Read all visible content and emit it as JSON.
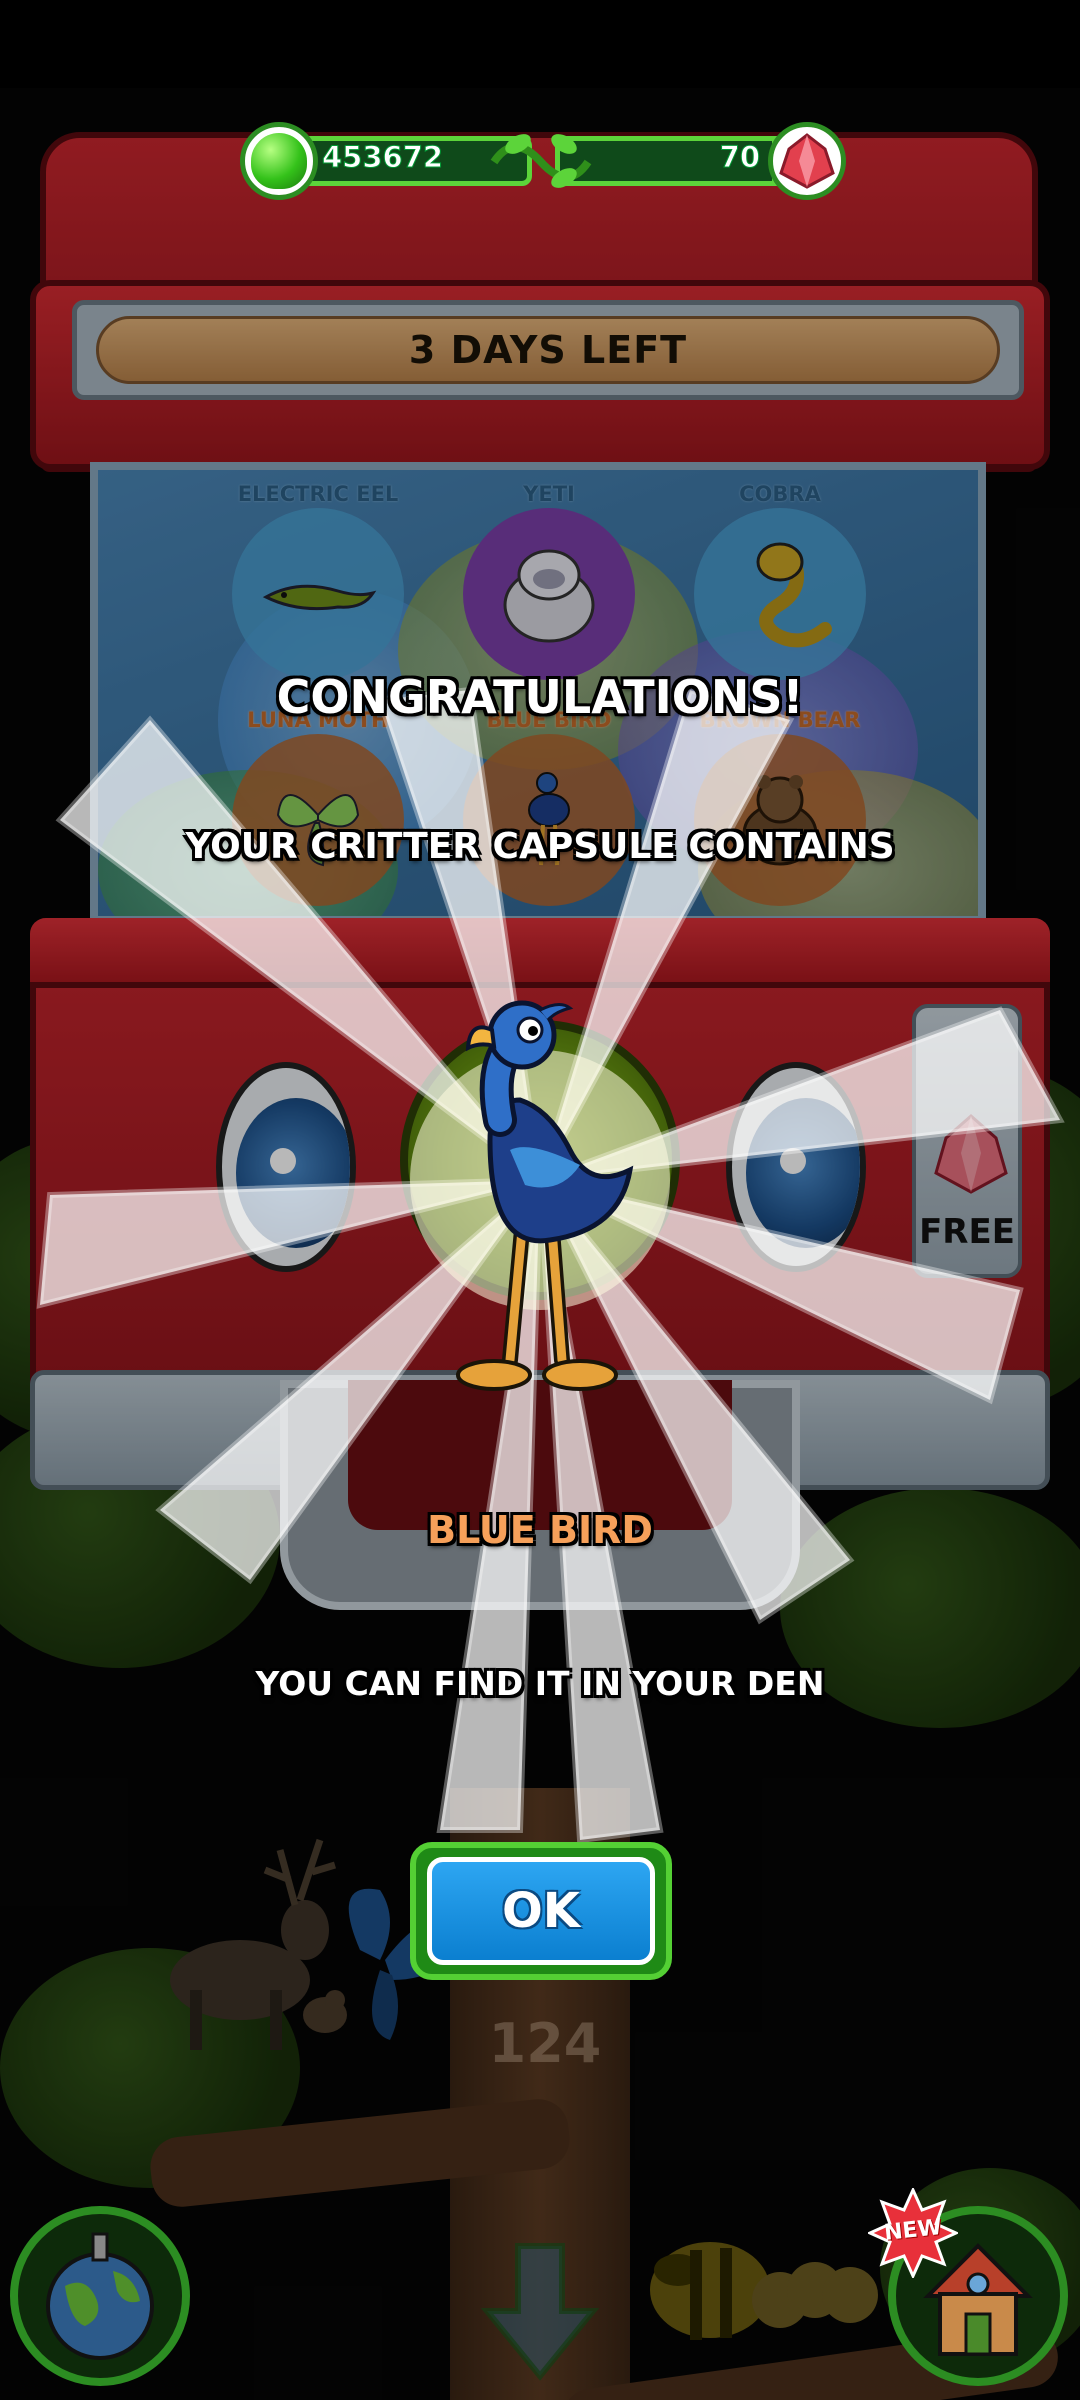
{
  "hud": {
    "green_gems": "453672",
    "red_gems": "70"
  },
  "machine": {
    "timer_banner": "3 DAYS LEFT",
    "free_label": "FREE",
    "slots": [
      {
        "label": "ELECTRIC EEL",
        "color": "#4aa0d2"
      },
      {
        "label": "YETI",
        "color": "#7a3fa8"
      },
      {
        "label": "COBRA",
        "color": "#4aa0d2"
      },
      {
        "label": "LUNA MOTH",
        "color": "#b0642e"
      },
      {
        "label": "BLUE BIRD",
        "color": "#b0642e"
      },
      {
        "label": "BROWN BEAR",
        "color": "#b0642e"
      }
    ]
  },
  "reward": {
    "title": "CONGRATULATIONS!",
    "subtitle": "YOUR CRITTER CAPSULE CONTAINS",
    "critter_name": "BLUE BIRD",
    "message": "YOU CAN FIND IT IN YOUR DEN",
    "ok_label": "OK"
  },
  "scene": {
    "level_number": "124",
    "new_badge": "NEW"
  },
  "colors": {
    "accent_green": "#54d034",
    "ok_blue": "#1b95e6",
    "machine_red": "#c8262e",
    "critter_name_orange": "#f6a05a"
  }
}
